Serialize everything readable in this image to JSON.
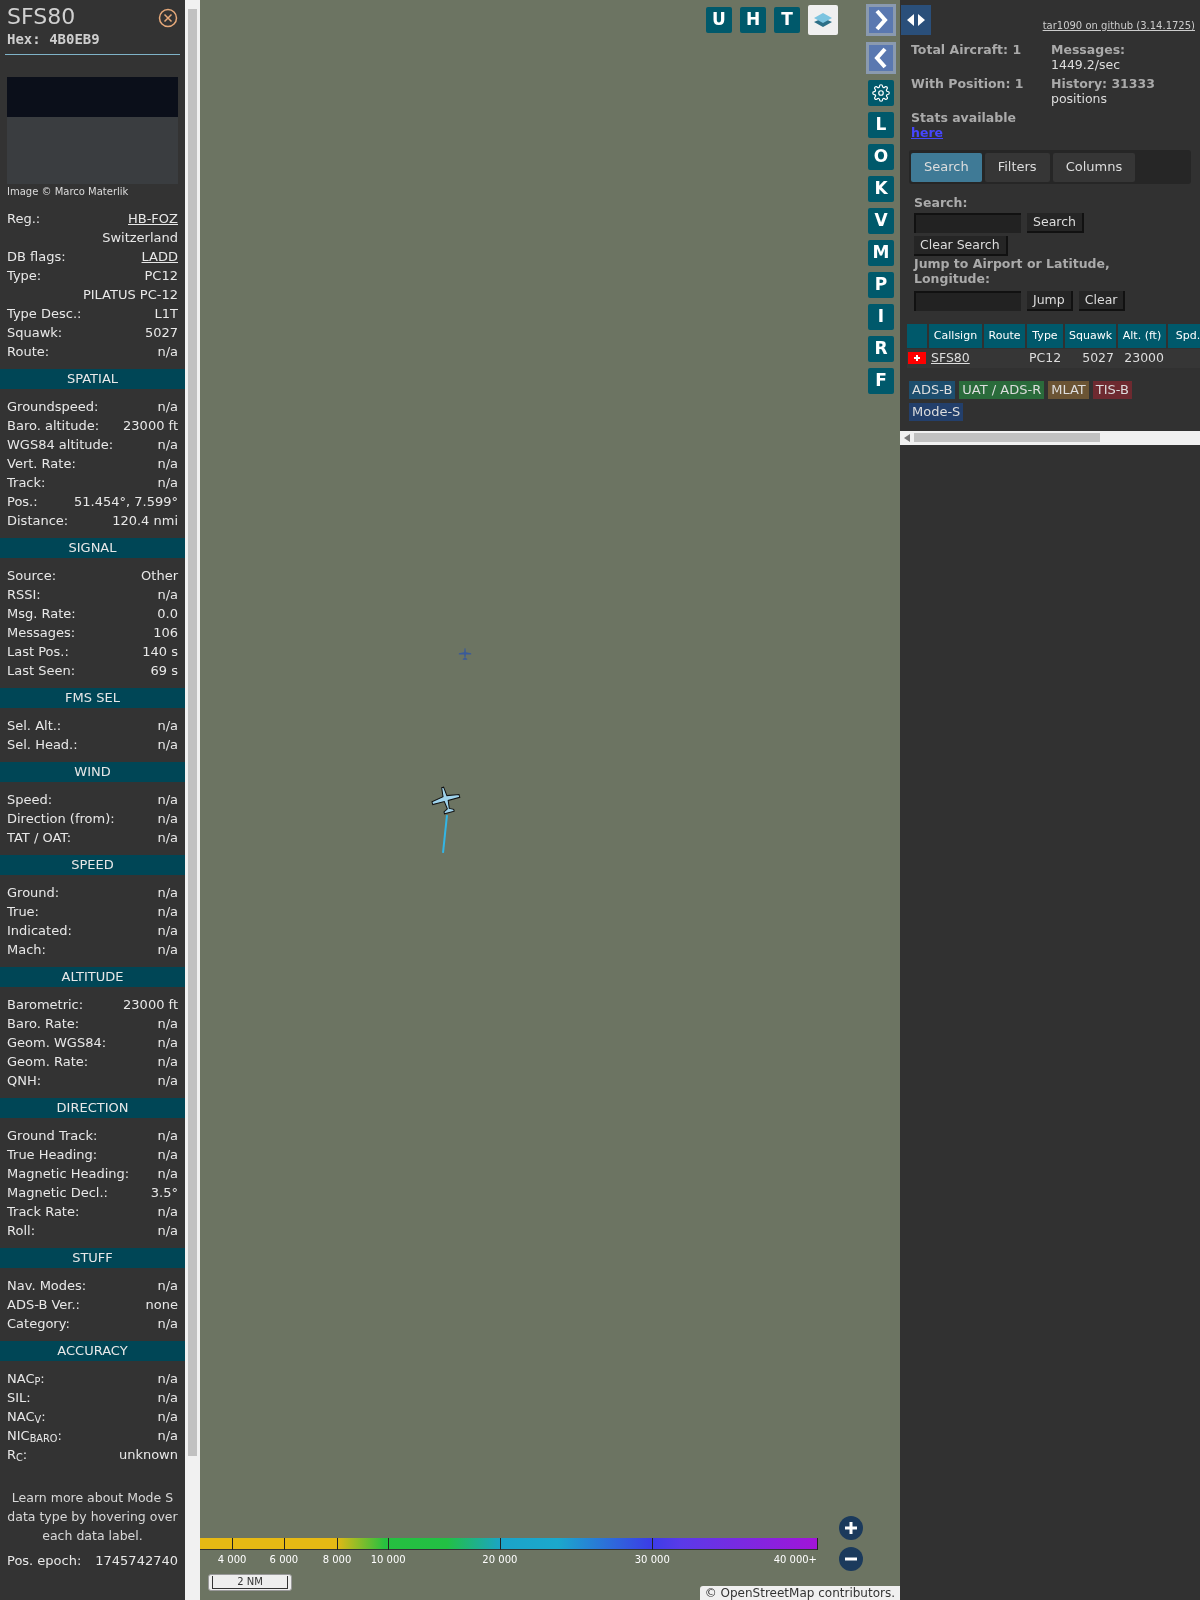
{
  "detail": {
    "callsign": "SFS80",
    "hex": "Hex: 4B0EB9",
    "photo_credit": "Image © Marco Materlik",
    "rows": [
      {
        "label": "Reg.:",
        "value": "HB-FOZ",
        "link": true,
        "extra": "Switzerland"
      },
      {
        "label": "DB flags:",
        "value": "LADD",
        "link": true
      },
      {
        "label": "Type:",
        "value": "PC12",
        "link": false,
        "extra": "PILATUS PC-12"
      },
      {
        "label": "Type Desc.:",
        "value": "L1T",
        "link": false
      },
      {
        "label": "Squawk:",
        "value": "5027",
        "link": false
      },
      {
        "label": "Route:",
        "value": "n/a",
        "link": false
      }
    ],
    "sections": [
      {
        "title": "SPATIAL",
        "rows": [
          {
            "label": "Groundspeed:",
            "value": "n/a"
          },
          {
            "label": "Baro. altitude:",
            "value": "23000 ft"
          },
          {
            "label": "WGS84 altitude:",
            "value": "n/a"
          },
          {
            "label": "Vert. Rate:",
            "value": "n/a"
          },
          {
            "label": "Track:",
            "value": "n/a"
          },
          {
            "label": "Pos.:",
            "value": "51.454°, 7.599°"
          },
          {
            "label": "Distance:",
            "value": "120.4 nmi"
          }
        ]
      },
      {
        "title": "SIGNAL",
        "rows": [
          {
            "label": "Source:",
            "value": "Other"
          },
          {
            "label": "RSSI:",
            "value": "n/a"
          },
          {
            "label": "Msg. Rate:",
            "value": "0.0"
          },
          {
            "label": "Messages:",
            "value": "106"
          },
          {
            "label": "Last Pos.:",
            "value": "140 s"
          },
          {
            "label": "Last Seen:",
            "value": "69 s"
          }
        ]
      },
      {
        "title": "FMS SEL",
        "rows": [
          {
            "label": "Sel. Alt.:",
            "value": "n/a"
          },
          {
            "label": "Sel. Head.:",
            "value": "n/a"
          }
        ]
      },
      {
        "title": "WIND",
        "rows": [
          {
            "label": "Speed:",
            "value": "n/a"
          },
          {
            "label": "Direction (from):",
            "value": "n/a"
          },
          {
            "label": "TAT / OAT:",
            "value": "n/a"
          }
        ]
      },
      {
        "title": "SPEED",
        "rows": [
          {
            "label": "Ground:",
            "value": "n/a"
          },
          {
            "label": "True:",
            "value": "n/a"
          },
          {
            "label": "Indicated:",
            "value": "n/a"
          },
          {
            "label": "Mach:",
            "value": "n/a"
          }
        ]
      },
      {
        "title": "ALTITUDE",
        "rows": [
          {
            "label": "Barometric:",
            "value": "23000 ft"
          },
          {
            "label": "Baro. Rate:",
            "value": "n/a"
          },
          {
            "label": "Geom. WGS84:",
            "value": "n/a"
          },
          {
            "label": "Geom. Rate:",
            "value": "n/a"
          },
          {
            "label": "QNH:",
            "value": "n/a"
          }
        ]
      },
      {
        "title": "DIRECTION",
        "rows": [
          {
            "label": "Ground Track:",
            "value": "n/a"
          },
          {
            "label": "True Heading:",
            "value": "n/a"
          },
          {
            "label": "Magnetic Heading:",
            "value": "n/a"
          },
          {
            "label": "Magnetic Decl.:",
            "value": "3.5°"
          },
          {
            "label": "Track Rate:",
            "value": "n/a"
          },
          {
            "label": "Roll:",
            "value": "n/a"
          }
        ]
      },
      {
        "title": "STUFF",
        "rows": [
          {
            "label": "Nav. Modes:",
            "value": "n/a"
          },
          {
            "label": "ADS-B Ver.:",
            "value": "none"
          },
          {
            "label": "Category:",
            "value": "n/a"
          }
        ]
      },
      {
        "title": "ACCURACY",
        "rows": [
          {
            "label": "NAC$_{P}$:",
            "value": "n/a"
          },
          {
            "label": "SIL:",
            "value": "n/a"
          },
          {
            "label": "NAC$_{V}$:",
            "value": "n/a"
          },
          {
            "label": "NIC$_{BARO}$:",
            "value": "n/a"
          },
          {
            "label": "R$_{C}$:",
            "value": "unknown"
          }
        ]
      }
    ],
    "note": "Learn more about Mode S data type by hovering over each data label.",
    "epoch": {
      "label": "Pos. epoch:",
      "value": "1745742740"
    }
  },
  "map": {
    "top_buttons": [
      {
        "kind": "letter",
        "label": "U"
      },
      {
        "kind": "letter",
        "label": "H"
      },
      {
        "kind": "letter",
        "label": "T"
      },
      {
        "kind": "layers"
      }
    ],
    "side_buttons": [
      {
        "kind": "next"
      },
      {
        "kind": "prev"
      },
      {
        "kind": "settings"
      },
      {
        "kind": "letter",
        "label": "L"
      },
      {
        "kind": "letter",
        "label": "O"
      },
      {
        "kind": "letter",
        "label": "K"
      },
      {
        "kind": "letter",
        "label": "V"
      },
      {
        "kind": "letter",
        "label": "M"
      },
      {
        "kind": "letter",
        "label": "P"
      },
      {
        "kind": "letter",
        "label": "I"
      },
      {
        "kind": "letter",
        "label": "R"
      },
      {
        "kind": "letter",
        "label": "F"
      }
    ],
    "altitude_legend": [
      "4 000",
      "6 000",
      "8 000",
      "10 000",
      "20 000",
      "30 000",
      "40 000+"
    ],
    "scale": "2 NM",
    "attribution": "© OpenStreetMap contributors."
  },
  "panel": {
    "github_link": "tar1090 on github (3.14.1725)",
    "stats": [
      {
        "label": "Total Aircraft: 1"
      },
      {
        "label": "Messages:",
        "value": "1449.2/sec"
      },
      {
        "label": "With Position: 1"
      },
      {
        "label": "History: 31333",
        "value": "positions"
      }
    ],
    "stats_text": "Stats available",
    "stats_link": "here",
    "tabs": [
      {
        "label": "Search",
        "selected": true
      },
      {
        "label": "Filters",
        "selected": false
      },
      {
        "label": "Columns",
        "selected": false
      }
    ],
    "search_label": "Search:",
    "search_button": "Search",
    "clear_search_button": "Clear Search",
    "jump_label": "Jump to Airport or Latitude, Longitude:",
    "jump_button": "Jump",
    "clear_button": "Clear",
    "table": {
      "columns": [
        "Callsign",
        "Route",
        "Type",
        "Squawk",
        "Alt. (ft)",
        "Spd."
      ],
      "rows": [
        {
          "cells": [
            "SFS80",
            "",
            "PC12",
            "5027",
            "23000",
            ""
          ]
        }
      ]
    },
    "sources": [
      {
        "label": "ADS-B",
        "color": "#1d4e6e"
      },
      {
        "label": "UAT / ADS-R",
        "color": "#2a6b3b"
      },
      {
        "label": "MLAT",
        "color": "#6b5434"
      },
      {
        "label": "TIS-B",
        "color": "#6e2a30"
      },
      {
        "label": "Mode-S",
        "color": "#233f6b"
      }
    ]
  }
}
